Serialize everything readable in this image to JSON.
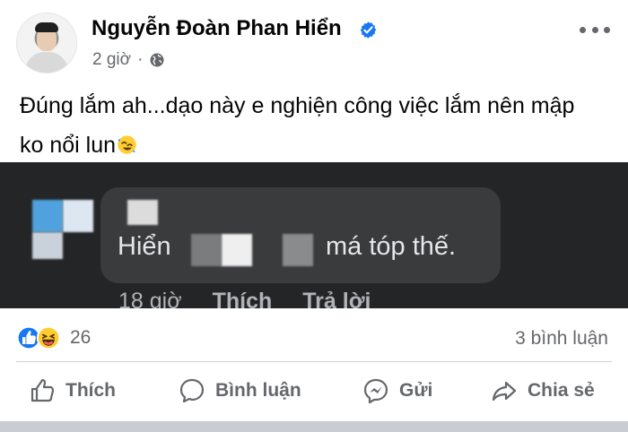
{
  "author": {
    "name": "Nguyễn Đoàn Phan Hiển",
    "verified": true,
    "avatar_icon": "profile-photo"
  },
  "post_meta": {
    "time": "2 giờ",
    "separator": "·",
    "privacy_icon": "globe-icon"
  },
  "more_icon": "more-dots-icon",
  "post": {
    "text_line1": "Đúng lắm ah...dạo này e nghiện công việc lắm nên mập",
    "text_line2": "ko nổi lun",
    "emoji": "rolling-on-floor-laughing"
  },
  "media": {
    "comment_name": "Hiển",
    "comment_text": "má tóp thế.",
    "time": "18 giờ",
    "like_label": "Thích",
    "reply_label": "Trả lời"
  },
  "reactions": {
    "icons": [
      "like-reaction-icon",
      "haha-reaction-icon"
    ],
    "count": "26"
  },
  "comments": {
    "count_label": "3 bình luận"
  },
  "actions": [
    {
      "label": "Thích",
      "icon": "like-icon"
    },
    {
      "label": "Bình luận",
      "icon": "comment-icon"
    },
    {
      "label": "Gửi",
      "icon": "messenger-icon"
    },
    {
      "label": "Chia sẻ",
      "icon": "share-icon"
    }
  ],
  "colors": {
    "blue": "#1877f2",
    "meta_gray": "#65676b",
    "dark_media": "#242526"
  }
}
